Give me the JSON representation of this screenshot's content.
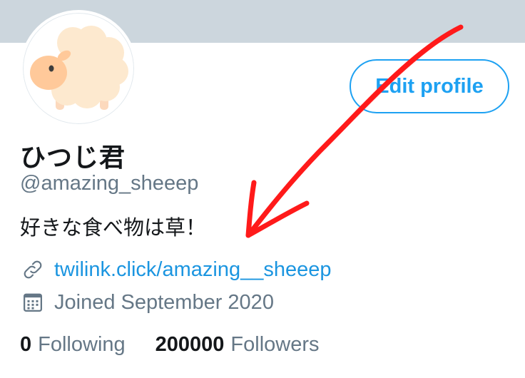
{
  "profile": {
    "display_name": "ひつじ君",
    "handle": "@amazing_sheeep",
    "bio": "好きな食べ物は草！",
    "link": "twilink.click/amazing__sheeep",
    "joined": "Joined September 2020"
  },
  "buttons": {
    "edit_profile": "Edit profile"
  },
  "stats": {
    "following_count": "0",
    "following_label": "Following",
    "followers_count": "200000",
    "followers_label": "Followers"
  },
  "icons": {
    "link": "link-icon",
    "calendar": "calendar-icon",
    "avatar": "sheep-avatar"
  },
  "colors": {
    "banner": "#ccd6dd",
    "accent": "#1da1f2",
    "link": "#1b95e0",
    "secondary_text": "#657786",
    "annotation_arrow": "#ff0000"
  }
}
